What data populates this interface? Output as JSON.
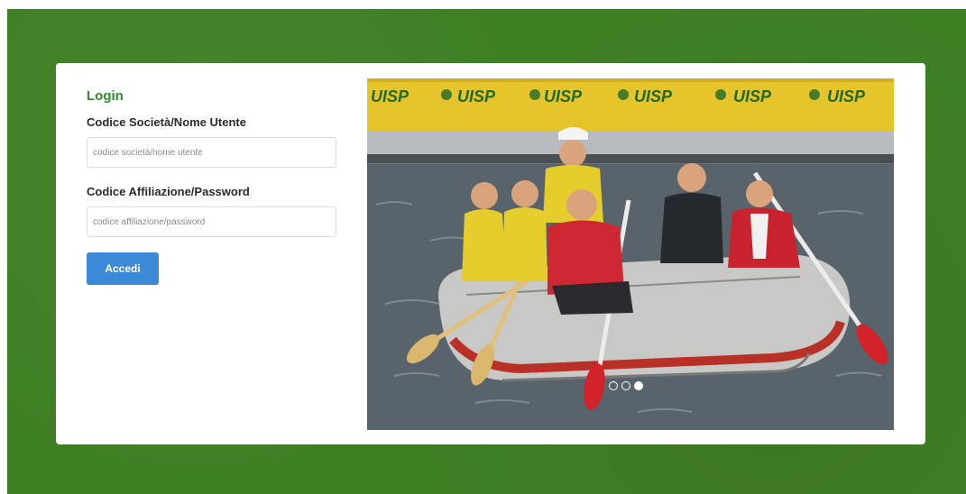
{
  "login": {
    "title": "Login",
    "username_label": "Codice Società/Nome Utente",
    "username_placeholder": "codice società/nome utente",
    "username_value": "",
    "password_label": "Codice Affiliazione/Password",
    "password_placeholder": "codice affiliazione/password",
    "password_value": "",
    "submit_label": "Accedi"
  },
  "carousel": {
    "banner_text": "UISP",
    "slide_count": 3,
    "active_slide": 3,
    "photo_subject": "children rowing an inflatable raft on water"
  },
  "colors": {
    "page_green": "#3f7f24",
    "title_green": "#2e8b2e",
    "button_blue": "#3b8ad9",
    "banner_yellow": "#e6c42b"
  }
}
